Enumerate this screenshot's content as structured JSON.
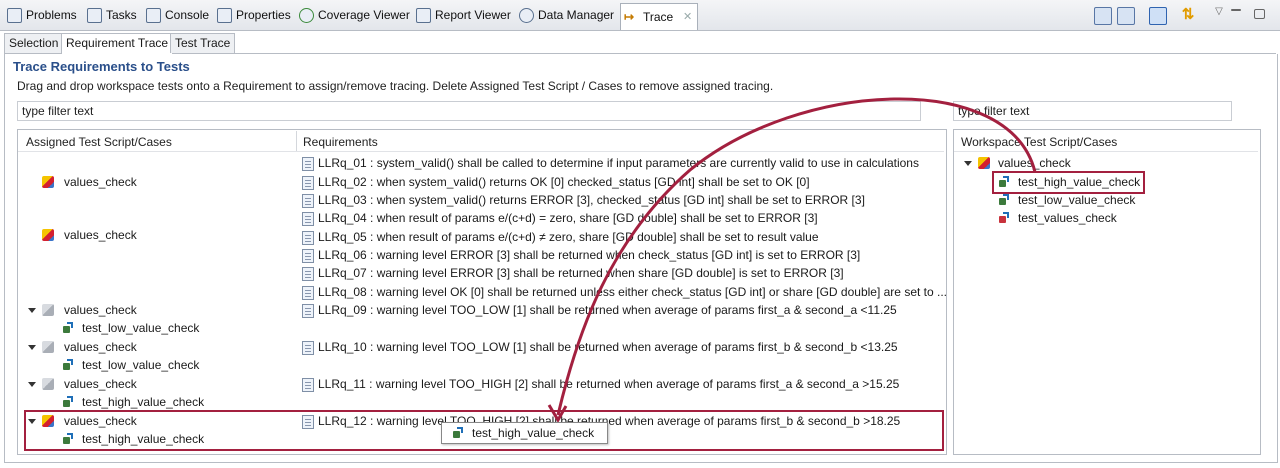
{
  "view_tabs": [
    {
      "label": "Problems",
      "icon": "problems-icon"
    },
    {
      "label": "Tasks",
      "icon": "tasks-icon"
    },
    {
      "label": "Console",
      "icon": "console-icon"
    },
    {
      "label": "Properties",
      "icon": "properties-icon"
    },
    {
      "label": "Coverage Viewer",
      "icon": "coverage-icon"
    },
    {
      "label": "Report Viewer",
      "icon": "report-icon"
    },
    {
      "label": "Data Manager",
      "icon": "gear-icon"
    },
    {
      "label": "Trace",
      "icon": "trace-icon",
      "active": true
    }
  ],
  "sub_tabs": [
    "Selection",
    "Requirement Trace",
    "Test Trace"
  ],
  "title": "Trace Requirements to Tests",
  "instructions": "Drag and drop workspace tests onto a Requirement to assign/remove tracing. Delete Assigned Test Script / Cases to remove assigned tracing.",
  "filter_placeholder": "type filter text",
  "columns": {
    "assigned": "Assigned Test Script/Cases",
    "requirements": "Requirements",
    "workspace": "Workspace Test Script/Cases"
  },
  "requirements": [
    "LLRq_01 : system_valid() shall be called to determine if input parameters are currently valid to use in calculations",
    "LLRq_02 : when system_valid() returns OK [0] checked_status [GD int] shall be set to OK [0]",
    "LLRq_03 : when system_valid() returns ERROR [3], checked_status [GD int] shall be set to ERROR [3]",
    "LLRq_04 : when result of params e/(c+d) = zero, share [GD double] shall be set to ERROR [3]",
    "LLRq_05 : when result of params e/(c+d) ≠ zero, share [GD double] shall be set to result value",
    "LLRq_06 : warning level ERROR [3] shall be returned when check_status [GD int] is set to ERROR [3]",
    "LLRq_07 : warning level ERROR [3] shall be returned when share [GD double] is set to ERROR [3]",
    "LLRq_08 : warning level OK [0] shall be returned unless either check_status [GD int] or share [GD double] are set to ...",
    "LLRq_09 : warning level TOO_LOW [1] shall be returned when average of params first_a & second_a  <11.25",
    "LLRq_10 : warning level TOO_LOW [1] shall be returned when average of params first_b & second_b  <13.25",
    "LLRq_11 : warning level TOO_HIGH [2] shall be returned when average of params first_a & second_a  >15.25",
    "LLRq_12 : warning level TOO_HIGH [2] shall be returned when average of params first_b & second_b  >18.25"
  ],
  "assigned": [
    {
      "script": "values_check"
    },
    {
      "script": "values_check"
    },
    {
      "script": "values_check",
      "case": "test_low_value_check"
    },
    {
      "script": "values_check",
      "case": "test_low_value_check"
    },
    {
      "script": "values_check",
      "case": "test_high_value_check"
    },
    {
      "script": "values_check",
      "case": "test_high_value_check"
    }
  ],
  "workspace": {
    "script": "values_check",
    "cases": [
      "test_high_value_check",
      "test_low_value_check",
      "test_values_check"
    ]
  },
  "drag_label": "test_high_value_check",
  "colors": {
    "highlight": "#a3203f",
    "title": "#2a4f8a"
  }
}
